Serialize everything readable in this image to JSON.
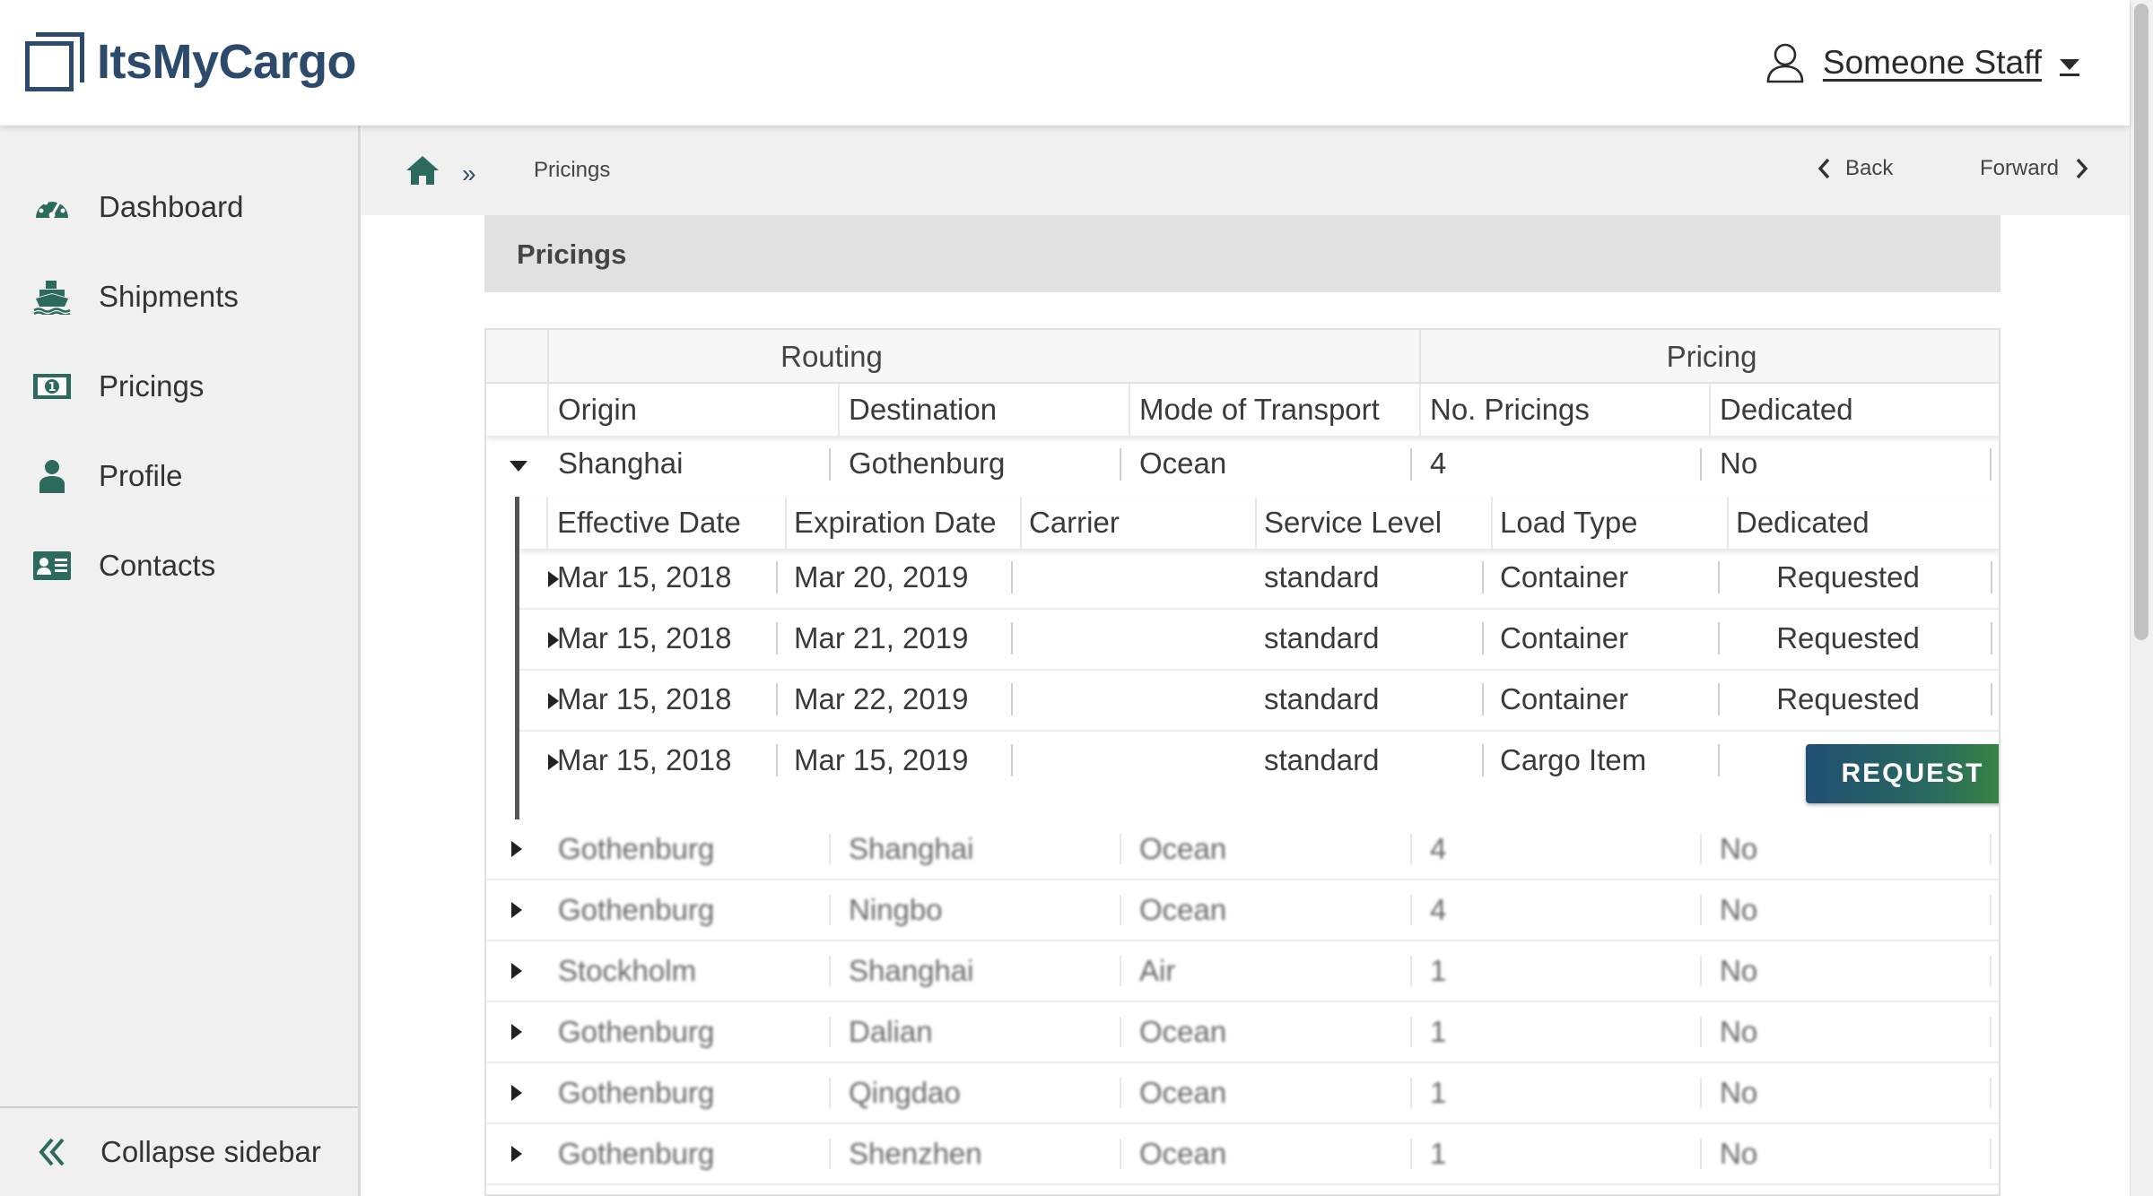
{
  "app": {
    "logo_text": "ItsMyCargo",
    "brand_color": "#2c4a6b",
    "accent_color": "#2b7a5f"
  },
  "user_menu": {
    "name": "Someone Staff",
    "icon": "user-icon"
  },
  "sidebar": {
    "items": [
      {
        "label": "Dashboard",
        "icon": "dashboard-gauge-icon"
      },
      {
        "label": "Shipments",
        "icon": "ship-icon"
      },
      {
        "label": "Pricings",
        "icon": "money-bill-icon"
      },
      {
        "label": "Profile",
        "icon": "person-icon"
      },
      {
        "label": "Contacts",
        "icon": "contact-card-icon"
      }
    ],
    "collapse_label": "Collapse sidebar"
  },
  "breadcrumb": {
    "current": "Pricings",
    "separator": "»"
  },
  "history_nav": {
    "back_label": "Back",
    "forward_label": "Forward"
  },
  "page": {
    "title": "Pricings"
  },
  "table": {
    "group_headers": {
      "routing": "Routing",
      "pricing": "Pricing"
    },
    "columns": [
      "Origin",
      "Destination",
      "Mode of Transport",
      "No. Pricings",
      "Dedicated"
    ],
    "expanded_row": {
      "origin": "Shanghai",
      "destination": "Gothenburg",
      "mode": "Ocean",
      "count": "4",
      "dedicated": "No"
    },
    "subtable": {
      "columns": [
        "Effective Date",
        "Expiration Date",
        "Carrier",
        "Service Level",
        "Load Type",
        "Dedicated"
      ],
      "rows": [
        {
          "effective": "Mar 15, 2018",
          "expiration": "Mar 20, 2019",
          "carrier": "",
          "service": "standard",
          "load": "Container",
          "dedicated": "Requested"
        },
        {
          "effective": "Mar 15, 2018",
          "expiration": "Mar 21, 2019",
          "carrier": "",
          "service": "standard",
          "load": "Container",
          "dedicated": "Requested"
        },
        {
          "effective": "Mar 15, 2018",
          "expiration": "Mar 22, 2019",
          "carrier": "",
          "service": "standard",
          "load": "Container",
          "dedicated": "Requested"
        },
        {
          "effective": "Mar 15, 2018",
          "expiration": "Mar 15, 2019",
          "carrier": "",
          "service": "standard",
          "load": "Cargo Item",
          "dedicated": ""
        }
      ],
      "request_button_label": "REQUEST"
    },
    "rows": [
      {
        "origin": "Gothenburg",
        "destination": "Shanghai",
        "mode": "Ocean",
        "count": "4",
        "dedicated": "No"
      },
      {
        "origin": "Gothenburg",
        "destination": "Ningbo",
        "mode": "Ocean",
        "count": "4",
        "dedicated": "No"
      },
      {
        "origin": "Stockholm",
        "destination": "Shanghai",
        "mode": "Air",
        "count": "1",
        "dedicated": "No"
      },
      {
        "origin": "Gothenburg",
        "destination": "Dalian",
        "mode": "Ocean",
        "count": "1",
        "dedicated": "No"
      },
      {
        "origin": "Gothenburg",
        "destination": "Qingdao",
        "mode": "Ocean",
        "count": "1",
        "dedicated": "No"
      },
      {
        "origin": "Gothenburg",
        "destination": "Shenzhen",
        "mode": "Ocean",
        "count": "1",
        "dedicated": "No"
      }
    ]
  }
}
